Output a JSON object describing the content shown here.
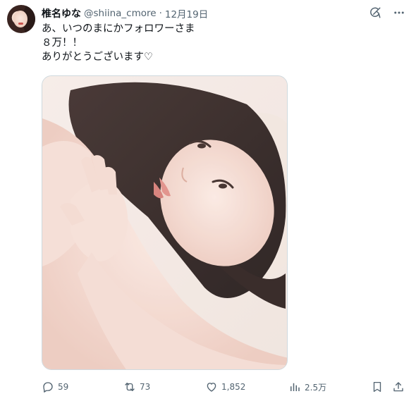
{
  "author": {
    "display_name": "椎名ゆな",
    "handle": "@shiina_cmore",
    "separator": "·",
    "date": "12月19日"
  },
  "tweet": {
    "lines": [
      "あ、いつのまにかフォロワーさま",
      "８万！！",
      "ありがとうございます♡"
    ]
  },
  "actions": {
    "reply_count": "59",
    "retweet_count": "73",
    "like_count": "1,852",
    "views_count": "2.5万"
  },
  "icons": {
    "grok": "grok-icon",
    "more": "more-icon",
    "reply": "reply-icon",
    "retweet": "retweet-icon",
    "like": "heart-icon",
    "views": "analytics-icon",
    "bookmark": "bookmark-icon",
    "share": "share-icon"
  },
  "colors": {
    "text": "#0f1419",
    "muted": "#536471",
    "border": "#cfd9de"
  }
}
